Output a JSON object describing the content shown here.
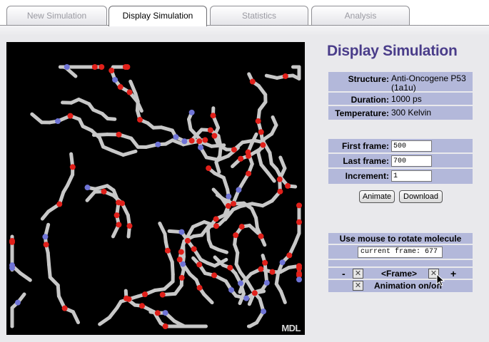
{
  "tabs": [
    {
      "label": "New Simulation",
      "active": false
    },
    {
      "label": "Display Simulation",
      "active": true
    },
    {
      "label": "Statistics",
      "active": false
    },
    {
      "label": "Analysis",
      "active": false
    }
  ],
  "page_title": "Display Simulation",
  "viewer": {
    "logo_text": "MDL"
  },
  "info": {
    "structure_label": "Structure:",
    "structure_value": "Anti-Oncogene P53 (1a1u)",
    "duration_label": "Duration:",
    "duration_value": "1000 ps",
    "temperature_label": "Temperature:",
    "temperature_value": "300 Kelvin"
  },
  "frames": {
    "first_label": "First frame:",
    "first_value": "500",
    "last_label": "Last frame:",
    "last_value": "700",
    "increment_label": "Increment:",
    "increment_value": "1"
  },
  "buttons": {
    "animate": "Animate",
    "download": "Download"
  },
  "controls": {
    "header": "Use mouse to rotate molecule",
    "current_frame": "current frame: 677",
    "minus": "-",
    "plus": "+",
    "frame_label": "<Frame>",
    "animation_label": "Animation on/off",
    "check_glyph": "✕"
  },
  "colors": {
    "title": "#4a3d8a",
    "panel": "#b3b8da",
    "viewer_bg": "#000000",
    "bond": "#c8c8c8",
    "oxygen": "#e0201a",
    "nitrogen": "#6f74d6"
  }
}
